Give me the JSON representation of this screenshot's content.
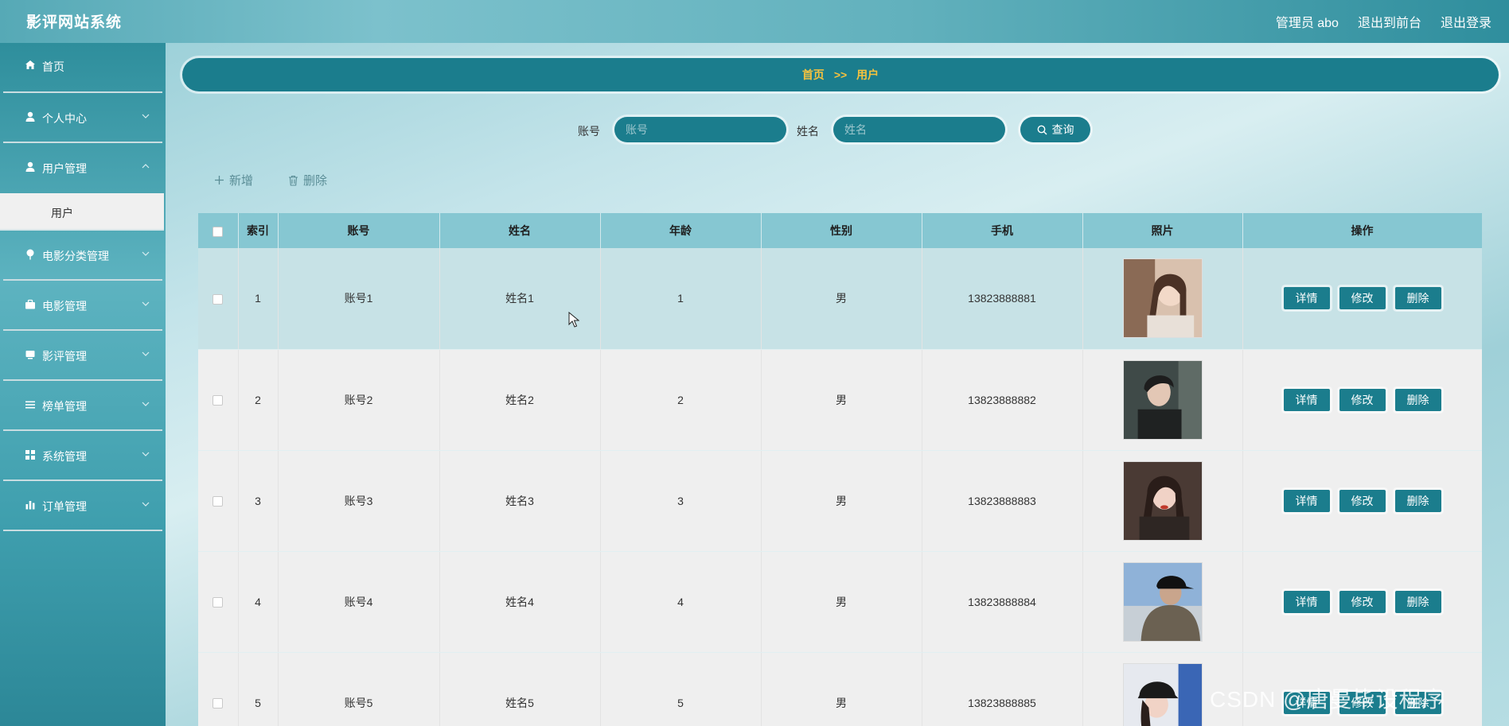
{
  "header": {
    "brand": "影评网站系统",
    "user": "管理员 abo",
    "to_front": "退出到前台",
    "logout": "退出登录"
  },
  "sidebar": {
    "items": [
      {
        "label": "首页",
        "icon": "home-icon"
      },
      {
        "label": "个人中心",
        "icon": "user-icon"
      },
      {
        "label": "用户管理",
        "icon": "user-icon"
      },
      {
        "label": "电影分类管理",
        "icon": "pin-icon"
      },
      {
        "label": "电影管理",
        "icon": "briefcase-icon"
      },
      {
        "label": "影评管理",
        "icon": "monitor-icon"
      },
      {
        "label": "榜单管理",
        "icon": "list-icon"
      },
      {
        "label": "系统管理",
        "icon": "grid-icon"
      },
      {
        "label": "订单管理",
        "icon": "bar-chart-icon"
      }
    ],
    "submenu_user": "用户"
  },
  "breadcrumb": {
    "home": "首页",
    "sep": ">>",
    "current": "用户"
  },
  "search": {
    "account_label": "账号",
    "account_placeholder": "账号",
    "name_label": "姓名",
    "name_placeholder": "姓名",
    "query_label": "查询"
  },
  "actions": {
    "add": "新增",
    "delete": "删除"
  },
  "table": {
    "headers": [
      "索引",
      "账号",
      "姓名",
      "年龄",
      "性别",
      "手机",
      "照片",
      "操作"
    ],
    "rows": [
      {
        "index": "1",
        "account": "账号1",
        "name": "姓名1",
        "age": "1",
        "gender": "男",
        "phone": "13823888881"
      },
      {
        "index": "2",
        "account": "账号2",
        "name": "姓名2",
        "age": "2",
        "gender": "男",
        "phone": "13823888882"
      },
      {
        "index": "3",
        "account": "账号3",
        "name": "姓名3",
        "age": "3",
        "gender": "男",
        "phone": "13823888883"
      },
      {
        "index": "4",
        "account": "账号4",
        "name": "姓名4",
        "age": "4",
        "gender": "男",
        "phone": "13823888884"
      },
      {
        "index": "5",
        "account": "账号5",
        "name": "姓名5",
        "age": "5",
        "gender": "男",
        "phone": "13823888885"
      }
    ],
    "op_detail": "详情",
    "op_edit": "修改",
    "op_delete": "删除"
  },
  "watermark": "CSDN @唐曼毕设程序"
}
